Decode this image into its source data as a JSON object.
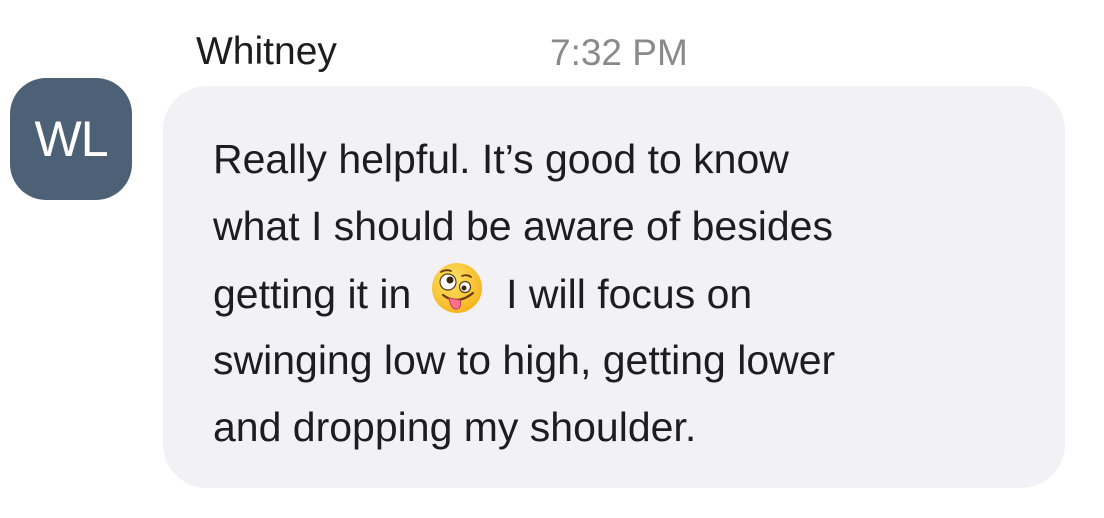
{
  "message": {
    "avatar_initials": "WL",
    "sender": "Whitney",
    "timestamp": "7:32 PM",
    "lines": [
      "Really helpful. It’s good to know",
      "what I should be aware of besides",
      "getting it in",
      "I will focus on",
      "swinging low to high, getting lower",
      "and dropping my shoulder."
    ],
    "emoji": "zany-face-emoji",
    "colors": {
      "avatar_bg": "#4d6176",
      "bubble_bg": "#f2f2f6",
      "timestamp": "#8a8a8e",
      "text": "#1d1d1f"
    }
  }
}
